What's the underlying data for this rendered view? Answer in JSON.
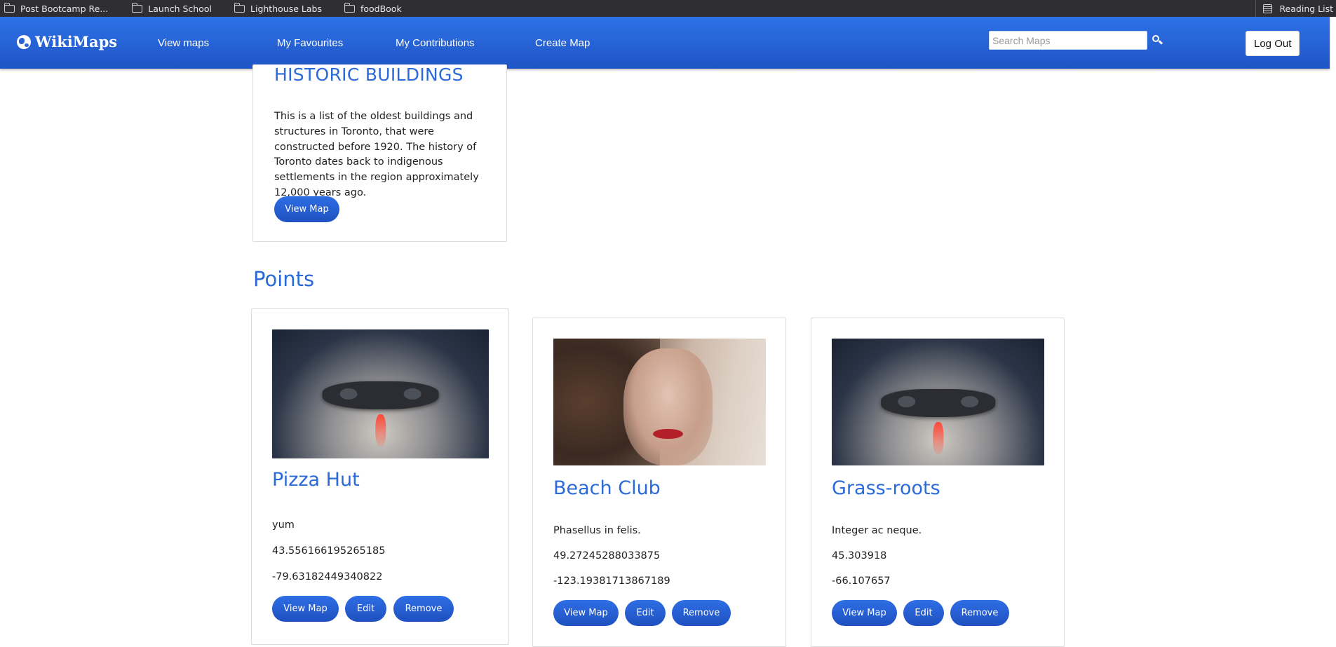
{
  "bookmarks": {
    "items": [
      "Post Bootcamp Re...",
      "Launch School",
      "Lighthouse Labs",
      "foodBook"
    ],
    "reading_list": "Reading List"
  },
  "nav": {
    "brand": "WikiMaps",
    "links": [
      "View maps",
      "My Favourites",
      "My Contributions",
      "Create Map"
    ],
    "search_placeholder": "Search Maps",
    "logout": "Log Out",
    "accent": "#2a64d8"
  },
  "map_card": {
    "title": "HISTORIC BUILDINGS",
    "description": "This is a list of the oldest buildings and structures in Toronto, that were constructed before 1920. The history of Toronto dates back to indigenous settlements in the region approximately 12,000 years ago.",
    "view_label": "View Map"
  },
  "points_heading": "Points",
  "points": [
    {
      "title": "Pizza Hut",
      "description": "yum",
      "lat": "43.556166195265185",
      "lng": "-79.63182449340822",
      "image": "game-controller-image",
      "view_label": "View Map",
      "edit_label": "Edit",
      "remove_label": "Remove"
    },
    {
      "title": "Beach Club",
      "description": "Phasellus in felis.",
      "lat": "49.27245288033875",
      "lng": "-123.19381713867189",
      "image": "woman-portrait-image",
      "view_label": "View Map",
      "edit_label": "Edit",
      "remove_label": "Remove"
    },
    {
      "title": "Grass-roots",
      "description": "Integer ac neque.",
      "lat": "45.303918",
      "lng": "-66.107657",
      "image": "game-controller-image",
      "view_label": "View Map",
      "edit_label": "Edit",
      "remove_label": "Remove"
    }
  ]
}
